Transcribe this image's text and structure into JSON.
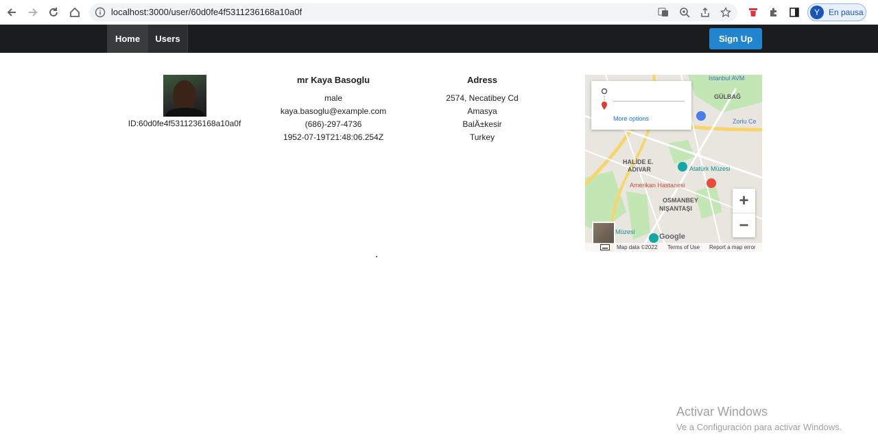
{
  "browser": {
    "url": "localhost:3000/user/60d0fe4f5311236168a10a0f",
    "profile_initial": "Y",
    "profile_status": "En pausa"
  },
  "navbar": {
    "home_label": "Home",
    "users_label": "Users",
    "signup_label": "Sign Up"
  },
  "user": {
    "id_text": "ID:60d0fe4f5311236168a10a0f",
    "name": "mr Kaya Basoglu",
    "gender": "male",
    "email": "kaya.basoglu@example.com",
    "phone": "(686)-297-4736",
    "dob": "1952-07-19T21:48:06.254Z"
  },
  "address": {
    "title": "Adress",
    "street": "2574, Necatibey Cd",
    "city": "Amasya",
    "state": "BalÄ±kesir",
    "country": "Turkey"
  },
  "map": {
    "more_options": "More options",
    "labels": {
      "istanbul_avm": "Istanbul AVM",
      "gulbag": "GÜLBAĞ",
      "zorlu": "Zorlu Ce",
      "halide": "HALİDE E.",
      "adivar": "ADIVAR",
      "ataturk": "Atatürk Müzesi",
      "amerikan": "Amerikan Hastanesi",
      "osmanbey": "OSMANBEY",
      "nisantasi": "NIŞANTAŞI",
      "muzesi": "Müzesi",
      "google": "Google"
    },
    "footer": {
      "map_data": "Map data ©2022",
      "terms": "Terms of Use",
      "report": "Report a map error"
    },
    "colors": {
      "park": "#c3e6b5",
      "road_major": "#f8d56b",
      "road_minor": "#ffffff",
      "land": "#e9e6df"
    }
  },
  "watermark": {
    "line1": "Activar Windows",
    "line2": "Ve a Configuración para activar Windows."
  },
  "colors": {
    "navbar_bg": "#1b1c1d",
    "signup_bg": "#2185d0"
  }
}
